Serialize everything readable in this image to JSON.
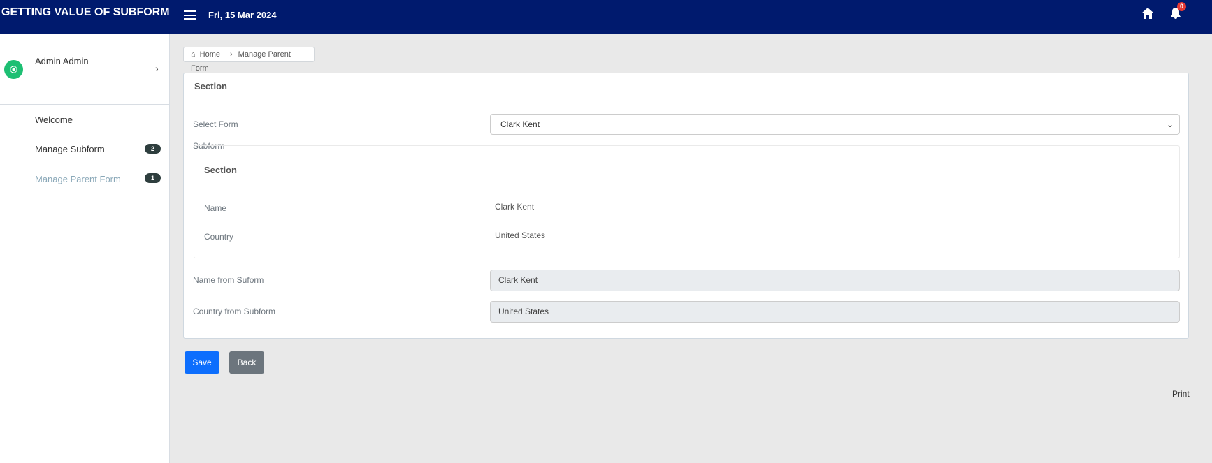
{
  "header": {
    "title": "GETTING VALUE OF SUBFORM",
    "date": "Fri, 15 Mar 2024",
    "notification_count": "0"
  },
  "sidebar": {
    "user": "Admin Admin",
    "items": [
      {
        "label": "Welcome"
      },
      {
        "label": "Manage Subform",
        "badge": "2"
      },
      {
        "label": "Manage Parent Form",
        "badge": "1"
      }
    ]
  },
  "breadcrumb": {
    "home": "Home",
    "current": "Manage Parent Form"
  },
  "form": {
    "section_title": "Section",
    "select_label": "Select Form",
    "select_value": "Clark Kent",
    "subform": {
      "label": "Subform",
      "section_title": "Section",
      "name_label": "Name",
      "name_value": "Clark Kent",
      "country_label": "Country",
      "country_value": "United States"
    },
    "name_from_label": "Name from Suform",
    "name_from_value": "Clark Kent",
    "country_from_label": "Country from Subform",
    "country_from_value": "United States"
  },
  "actions": {
    "save": "Save",
    "back": "Back",
    "print": "Print"
  },
  "colors": {
    "header": "#001a6e",
    "primary": "#0d6efd",
    "secondary": "#6c757d"
  }
}
